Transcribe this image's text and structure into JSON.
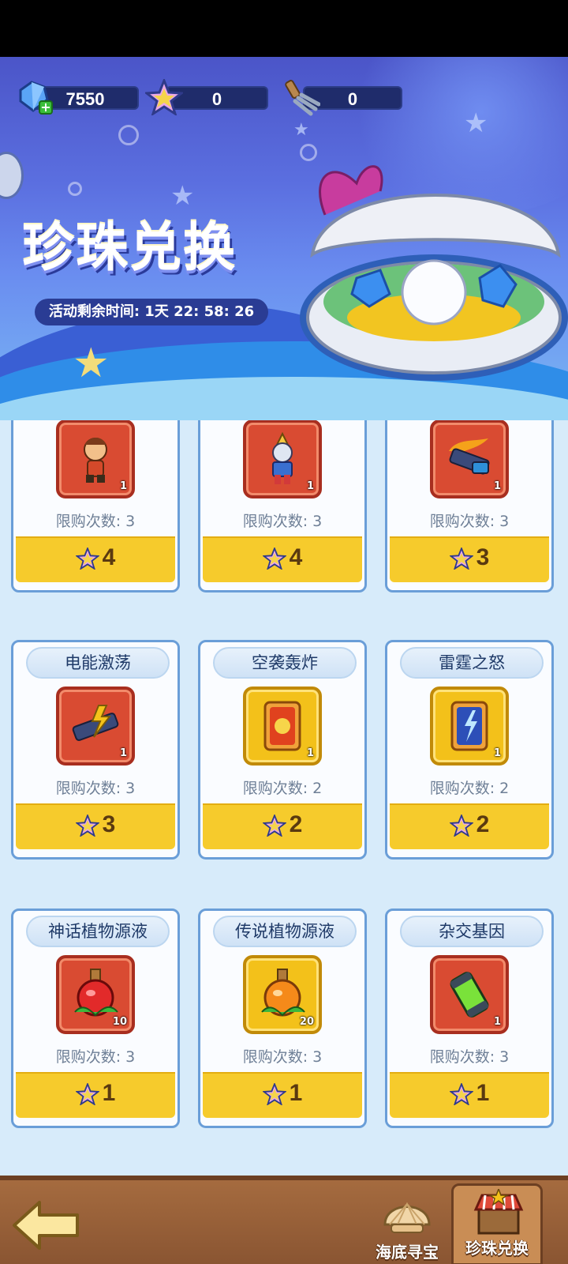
{
  "header": {
    "currencies": [
      {
        "name": "gem",
        "value": "7550"
      },
      {
        "name": "star-token",
        "value": "0"
      },
      {
        "name": "rake",
        "value": "0"
      }
    ],
    "title": "珍珠兑换",
    "timer": "活动剩余时间: 1天 22: 58: 26"
  },
  "shop": {
    "limit_label": "限购次数: ",
    "rows": [
      {
        "items": [
          {
            "name": "",
            "qty": "1",
            "limit": "3",
            "price": "4",
            "frame": "red"
          },
          {
            "name": "",
            "qty": "1",
            "limit": "3",
            "price": "4",
            "frame": "red"
          },
          {
            "name": "",
            "qty": "1",
            "limit": "3",
            "price": "3",
            "frame": "red"
          }
        ]
      },
      {
        "items": [
          {
            "name": "电能激荡",
            "qty": "1",
            "limit": "3",
            "price": "3",
            "frame": "red"
          },
          {
            "name": "空袭轰炸",
            "qty": "1",
            "limit": "2",
            "price": "2",
            "frame": "gold"
          },
          {
            "name": "雷霆之怒",
            "qty": "1",
            "limit": "2",
            "price": "2",
            "frame": "gold"
          }
        ]
      },
      {
        "items": [
          {
            "name": "神话植物源液",
            "qty": "10",
            "limit": "3",
            "price": "1",
            "frame": "red"
          },
          {
            "name": "传说植物源液",
            "qty": "20",
            "limit": "3",
            "price": "1",
            "frame": "gold"
          },
          {
            "name": "杂交基因",
            "qty": "1",
            "limit": "3",
            "price": "1",
            "frame": "red"
          }
        ]
      }
    ]
  },
  "bottom_nav": {
    "back_icon": "back-arrow-icon",
    "tabs": [
      {
        "label": "海底寻宝",
        "icon": "shell-icon",
        "active": false
      },
      {
        "label": "珍珠兑换",
        "icon": "shop-stall-icon",
        "active": true
      }
    ]
  },
  "colors": {
    "price_bar": "#f6cb2c",
    "card_border": "#6a9ed8",
    "content_bg": "#d7ebfa",
    "bottom_bar": "#a56b3f"
  }
}
